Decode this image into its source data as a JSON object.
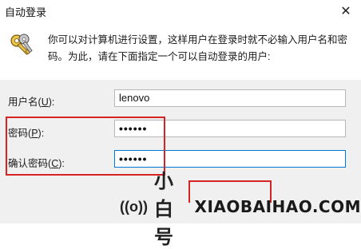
{
  "window": {
    "title": "自动登录",
    "close_glyph": "✕"
  },
  "header": {
    "description": "你可以对计算机进行设置，这样用户在登录时就不必输入用户名和密码。为此，请在下面指定一个可以自动登录的用户:"
  },
  "form": {
    "username": {
      "label": "用户名",
      "accesskey": "U",
      "value": "lenovo"
    },
    "password": {
      "label": "密码",
      "accesskey": "P",
      "value": "••••••"
    },
    "confirm_password": {
      "label": "确认密码",
      "accesskey": "C",
      "value": "••••••"
    }
  },
  "watermark": {
    "icon": "((o))",
    "brand_cn": "小白号",
    "brand_en": "XIAOBAIHAO.COM",
    "faint_cn": "@小白号",
    "faint_en": "XIAOBAIHAO.COM"
  },
  "colors": {
    "highlight_border": "#d62424",
    "focus_border": "#0078d7",
    "panel_bg": "#f0f0f0"
  }
}
